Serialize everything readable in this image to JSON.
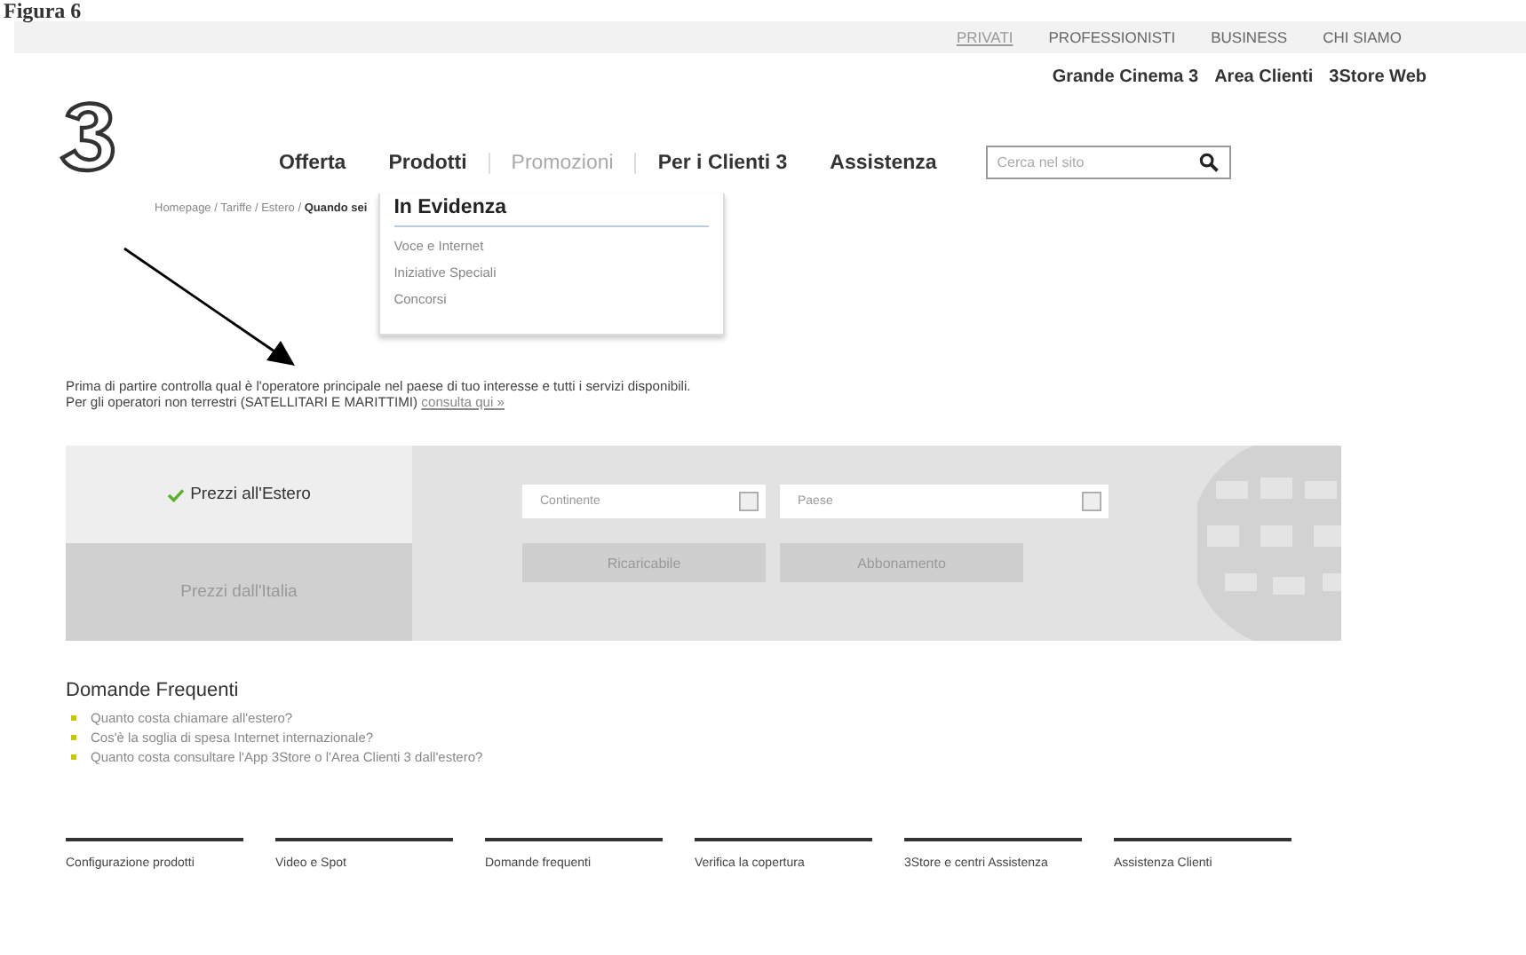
{
  "caption": "Figura 6",
  "top_links": [
    {
      "label": "PRIVATI",
      "selected": true
    },
    {
      "label": "PROFESSIONISTI",
      "selected": false
    },
    {
      "label": "BUSINESS",
      "selected": false
    },
    {
      "label": "CHI SIAMO",
      "selected": false
    }
  ],
  "quick_links": [
    "Grande Cinema 3",
    "Area Clienti",
    "3Store Web"
  ],
  "nav": [
    {
      "label": "Offerta",
      "selected": false
    },
    {
      "label": "Prodotti",
      "selected": false
    },
    {
      "label": "Promozioni",
      "selected": true
    },
    {
      "label": "Per i Clienti 3",
      "selected": false
    },
    {
      "label": "Assistenza",
      "selected": false
    }
  ],
  "search": {
    "placeholder": "Cerca nel sito"
  },
  "breadcrumb": "Homepage / Tariffe / Estero / **Quando sei**",
  "dropdown": {
    "heading": "In Evidenza",
    "items": [
      "Voce e Internet",
      "Iniziative Speciali",
      "Concorsi"
    ]
  },
  "intro": {
    "line1": "Prima di partire controlla qual è l'operatore principale nel paese di tuo interesse e tutti i servizi disponibili.",
    "line2": "Per gli operatori non terrestri (SATELLITARI E MARITTIMI)",
    "link": "consulta qui »"
  },
  "tabs": [
    {
      "label": "Prezzi all'Estero",
      "selected": true
    },
    {
      "label": "Prezzi dall'Italia",
      "selected": false
    }
  ],
  "selects": [
    {
      "placeholder": "Continente"
    },
    {
      "placeholder": "Paese"
    }
  ],
  "plan_buttons": [
    "Ricaricabile",
    "Abbonamento"
  ],
  "faq": {
    "title": "Domande Frequenti",
    "items": [
      "Quanto costa chiamare all'estero?",
      "Cos'è la soglia di spesa Internet internazionale?",
      "Quanto costa consultare l'App 3Store o l'Area Clienti 3 dall'estero?"
    ]
  },
  "footer_links": [
    "Configurazione prodotti",
    "Video e Spot",
    "Domande frequenti",
    "Verifica la copertura",
    "3Store e centri Assistenza",
    "Assistenza Clienti"
  ]
}
